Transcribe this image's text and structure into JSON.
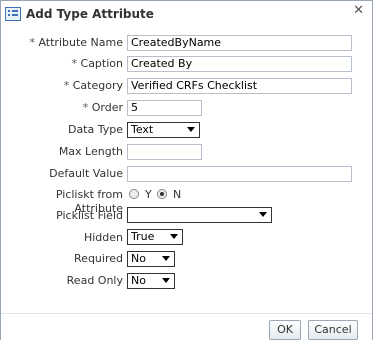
{
  "dialog": {
    "title": "Add Type Attribute",
    "close_glyph": "✕",
    "icon": "list-window-icon"
  },
  "form": {
    "attribute_name": {
      "label": "Attribute Name",
      "required": true,
      "value": "CreatedByName"
    },
    "caption": {
      "label": "Caption",
      "required": true,
      "value": "Created By"
    },
    "category": {
      "label": "Category",
      "required": true,
      "value": "Verified CRFs Checklist"
    },
    "order": {
      "label": "Order",
      "required": true,
      "value": "5"
    },
    "data_type": {
      "label": "Data Type",
      "value": "Text"
    },
    "max_length": {
      "label": "Max Length",
      "value": ""
    },
    "default_value": {
      "label": "Default Value",
      "value": ""
    },
    "picklist_from_attribute": {
      "label": "Picliskt from Attribute",
      "option_y": "Y",
      "option_n": "N",
      "selected": "N"
    },
    "picklist_field": {
      "label": "Picklist Field",
      "value": ""
    },
    "hidden": {
      "label": "Hidden",
      "value": "True"
    },
    "required": {
      "label": "Required",
      "value": "No"
    },
    "read_only": {
      "label": "Read Only",
      "value": "No"
    },
    "required_marker": "*"
  },
  "buttons": {
    "ok": "OK",
    "cancel": "Cancel"
  }
}
